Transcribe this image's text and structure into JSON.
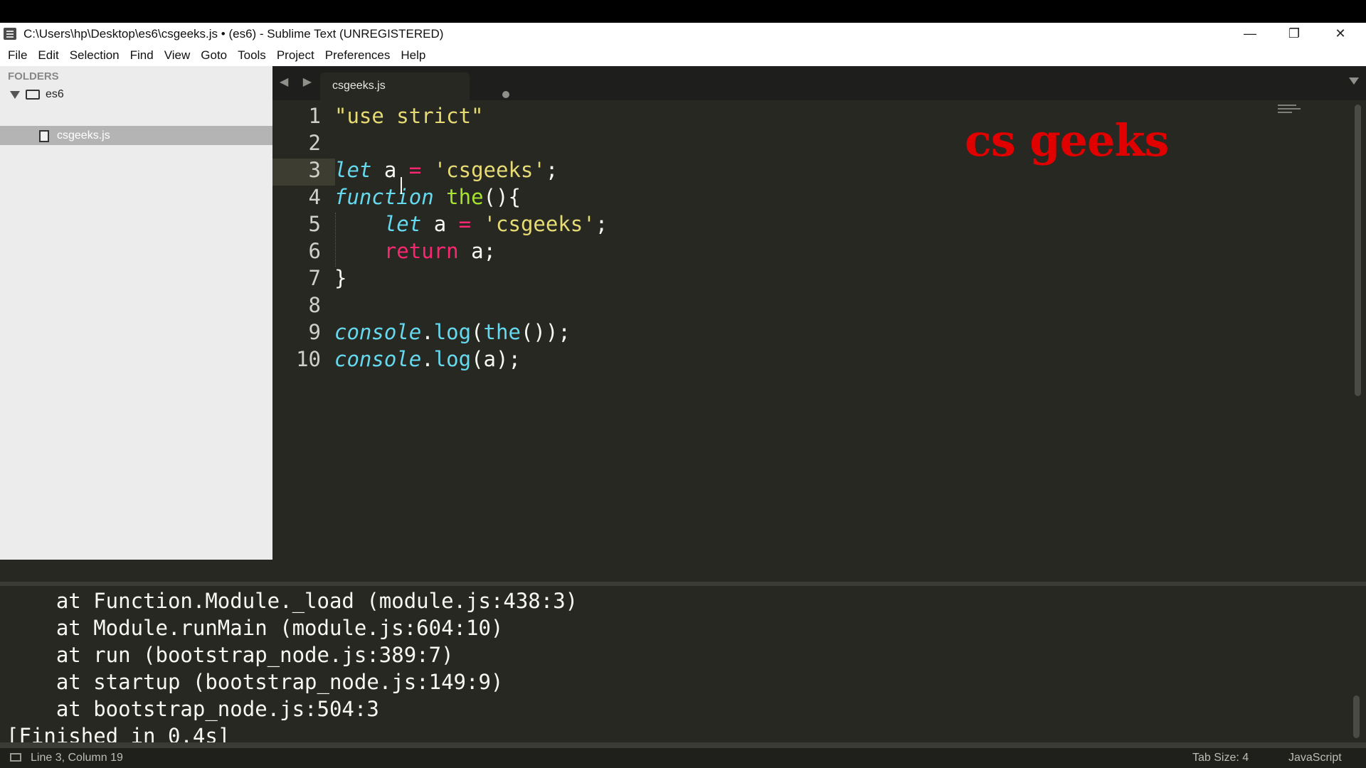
{
  "window": {
    "title": "C:\\Users\\hp\\Desktop\\es6\\csgeeks.js • (es6) - Sublime Text (UNREGISTERED)"
  },
  "menu": [
    "File",
    "Edit",
    "Selection",
    "Find",
    "View",
    "Goto",
    "Tools",
    "Project",
    "Preferences",
    "Help"
  ],
  "sidebar": {
    "header": "FOLDERS",
    "folder": "es6",
    "file": "csgeeks.js"
  },
  "tab": {
    "label": "csgeeks.js",
    "nav": "◀ ▶"
  },
  "editor": {
    "line_numbers": [
      "1",
      "2",
      "3",
      "4",
      "5",
      "6",
      "7",
      "8",
      "9",
      "10"
    ],
    "lines": [
      [
        {
          "t": "\"use strict\"",
          "c": "str"
        }
      ],
      [],
      [
        {
          "t": "let",
          "c": "kw"
        },
        {
          "t": " a ",
          "c": ""
        },
        {
          "t": "=",
          "c": "op"
        },
        {
          "t": " ",
          "c": ""
        },
        {
          "t": "'csgeeks'",
          "c": "str"
        },
        {
          "t": ";",
          "c": ""
        }
      ],
      [
        {
          "t": "function",
          "c": "kw"
        },
        {
          "t": " ",
          "c": ""
        },
        {
          "t": "the",
          "c": "fn"
        },
        {
          "t": "(){",
          "c": ""
        }
      ],
      [
        {
          "t": "    ",
          "c": ""
        },
        {
          "t": "let",
          "c": "kw"
        },
        {
          "t": " a ",
          "c": ""
        },
        {
          "t": "=",
          "c": "op"
        },
        {
          "t": " ",
          "c": ""
        },
        {
          "t": "'csgeeks'",
          "c": "str"
        },
        {
          "t": ";",
          "c": ""
        }
      ],
      [
        {
          "t": "    ",
          "c": ""
        },
        {
          "t": "return",
          "c": "ret"
        },
        {
          "t": " a;",
          "c": ""
        }
      ],
      [
        {
          "t": "}",
          "c": ""
        }
      ],
      [],
      [
        {
          "t": "console",
          "c": "obj"
        },
        {
          "t": ".",
          "c": ""
        },
        {
          "t": "log",
          "c": "meth"
        },
        {
          "t": "(",
          "c": ""
        },
        {
          "t": "the",
          "c": "meth"
        },
        {
          "t": "());",
          "c": ""
        }
      ],
      [
        {
          "t": "console",
          "c": "obj"
        },
        {
          "t": ".",
          "c": ""
        },
        {
          "t": "log",
          "c": "meth"
        },
        {
          "t": "(a);",
          "c": ""
        }
      ]
    ],
    "watermark": "cs geeks"
  },
  "output": {
    "lines": [
      "    at Function.Module._load (module.js:438:3)",
      "    at Module.runMain (module.js:604:10)",
      "    at run (bootstrap_node.js:389:7)",
      "    at startup (bootstrap_node.js:149:9)",
      "    at bootstrap_node.js:504:3",
      "[Finished in 0.4s]"
    ]
  },
  "status": {
    "position": "Line 3, Column 19",
    "tab_size": "Tab Size: 4",
    "syntax": "JavaScript"
  },
  "colors": {
    "background": "#272822",
    "keyword": "#66d9ef",
    "operator": "#f92672",
    "string": "#e6db74",
    "function": "#a6e22e",
    "watermark": "#e00000"
  }
}
